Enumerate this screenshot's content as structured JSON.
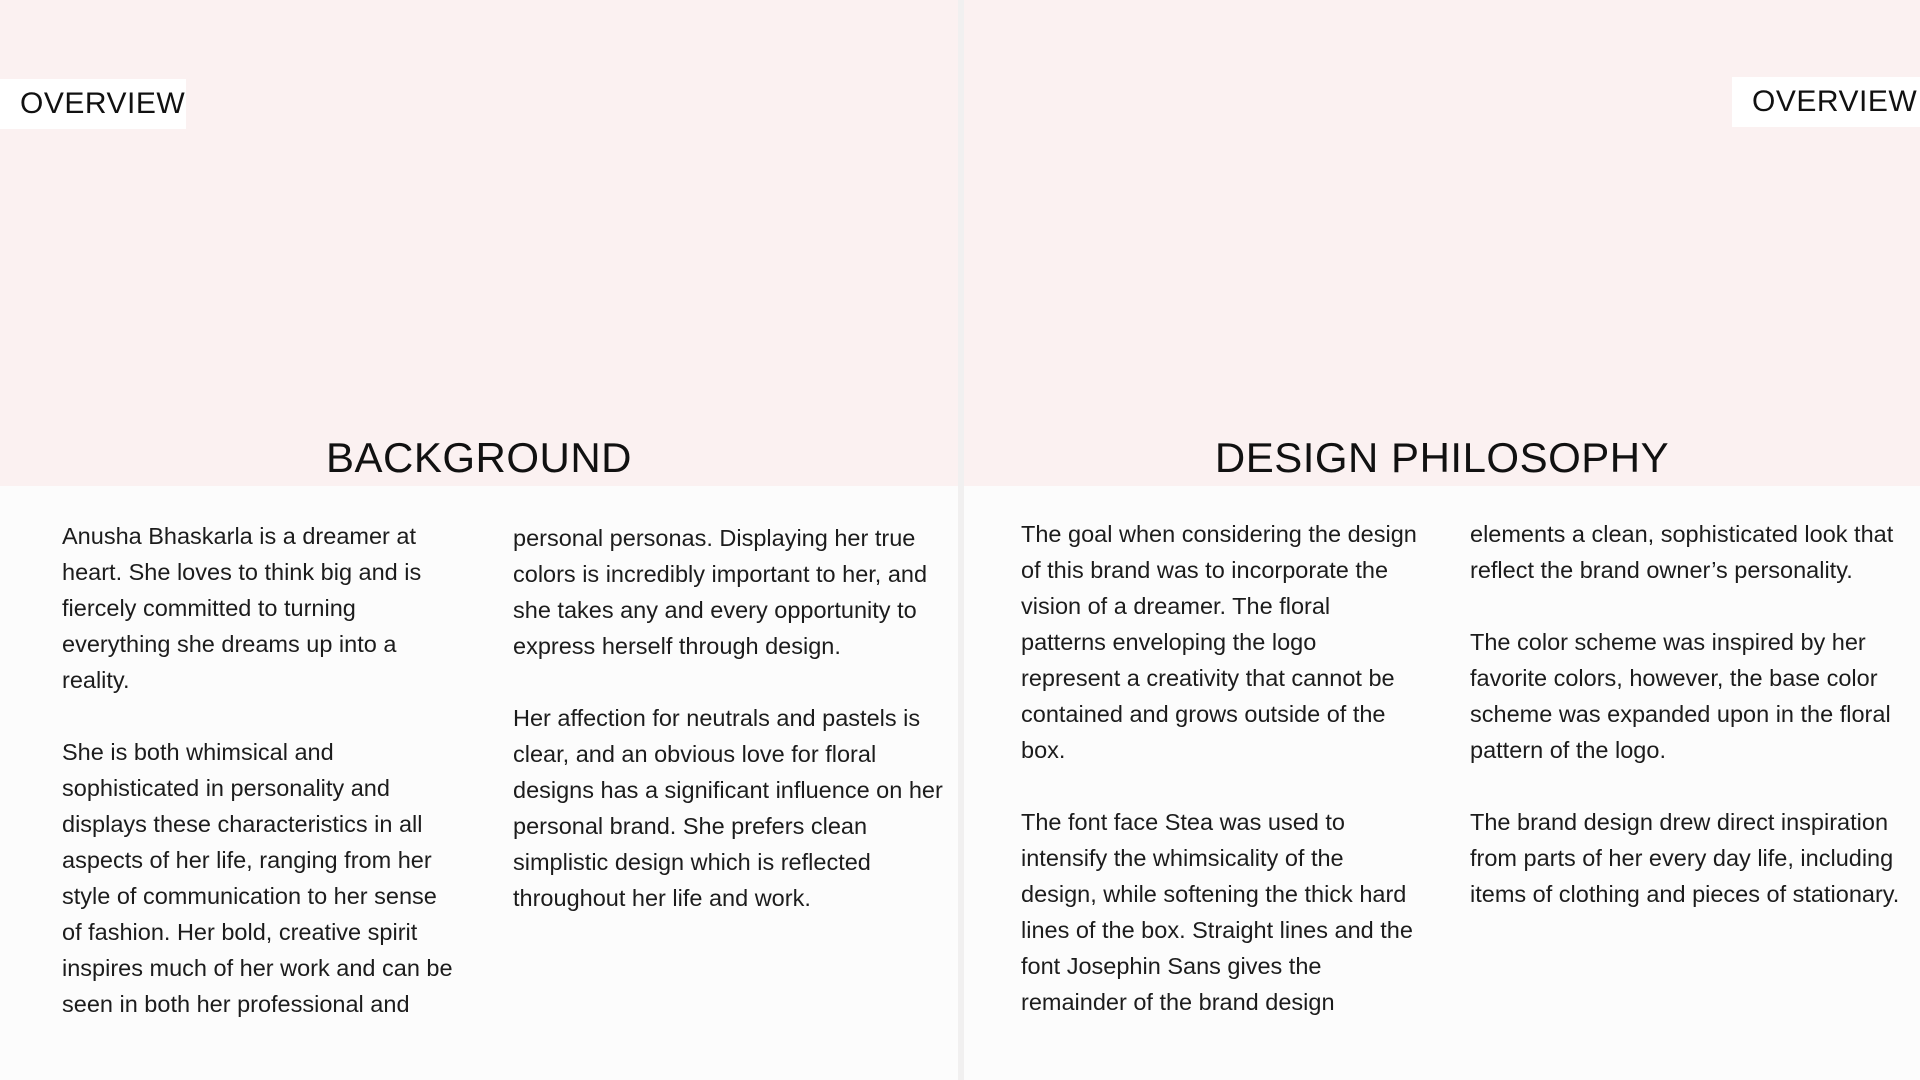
{
  "left_page": {
    "tag": "OVERVIEW",
    "heading": "BACKGROUND",
    "column1": [
      "Anusha Bhaskarla is a dreamer at heart. She loves to think big and is fiercely committed to turning everything she dreams up into a reality.",
      "She is both whimsical and sophisticated in personality and displays these characteristics in all aspects of her life, ranging from her style of communication to her sense of fashion. Her bold, creative spirit inspires much of her work and can be seen in both her professional and"
    ],
    "column2": [
      "personal personas. Displaying her true colors is incredibly important to her, and she takes any and every opportunity to express herself through design.",
      "Her affection for neutrals and pastels is clear, and an obvious love for floral designs has a significant influence on her personal brand. She prefers clean simplistic design which is reflected throughout her life and work."
    ]
  },
  "right_page": {
    "tag": "OVERVIEW",
    "heading": "DESIGN PHILOSOPHY",
    "column1": [
      "The goal when considering the design of this brand was to incorporate the vision of a dreamer. The floral patterns enveloping the logo represent a creativity that cannot be contained and grows outside of the box.",
      "The font face Stea was used to intensify the whimsicality of the design, while softening the thick hard lines of the box.  Straight lines and the font Josephin Sans gives the remainder of the brand design"
    ],
    "column2": [
      "elements a clean, sophisticated look that reflect the brand owner’s personality.",
      "The color scheme was inspired by her favorite colors, however, the base color scheme was expanded upon in the floral pattern of the logo.",
      "The brand design drew direct inspiration from parts of her every day life, including items of clothing and pieces of stationary."
    ]
  },
  "colors": {
    "banner": "#fbf1f1",
    "page": "#fcfcfc",
    "tag_bg": "#ffffff",
    "text": "#1c1c1c"
  }
}
